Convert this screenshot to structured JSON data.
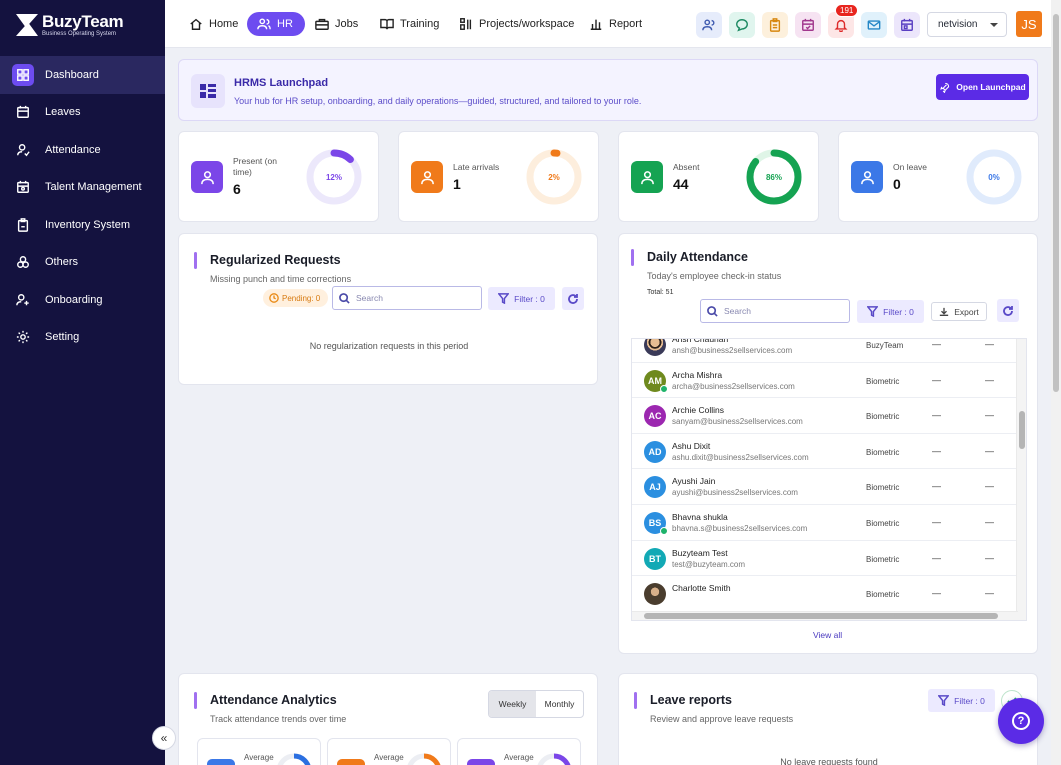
{
  "brand": {
    "name": "BuzyTeam",
    "tagline": "Business Operating System"
  },
  "sidebar": {
    "items": [
      {
        "label": "Dashboard",
        "icon": "dashboard-icon"
      },
      {
        "label": "Leaves",
        "icon": "calendar-icon"
      },
      {
        "label": "Attendance",
        "icon": "user-check-icon"
      },
      {
        "label": "Talent Management",
        "icon": "calendar-user-icon"
      },
      {
        "label": "Inventory System",
        "icon": "clipboard-icon"
      },
      {
        "label": "Others",
        "icon": "circles-icon"
      },
      {
        "label": "Onboarding",
        "icon": "user-plus-icon"
      },
      {
        "label": "Setting",
        "icon": "gear-icon"
      }
    ],
    "active": 0,
    "collapse_label": "«"
  },
  "topnav": {
    "tabs": [
      {
        "label": "Home",
        "icon": "home-icon"
      },
      {
        "label": "HR",
        "icon": "users-icon"
      },
      {
        "label": "Jobs",
        "icon": "briefcase-icon"
      },
      {
        "label": "Training",
        "icon": "book-icon"
      },
      {
        "label": "Projects/workspace",
        "icon": "projects-icon"
      },
      {
        "label": "Report",
        "icon": "bar-chart-icon"
      }
    ],
    "active": 1,
    "notification_count": "191",
    "org": "netvision",
    "user_initials": "JS"
  },
  "launchpad": {
    "title": "HRMS Launchpad",
    "subtitle": "Your hub for HR setup, onboarding, and daily operations—guided, structured, and tailored to your role.",
    "button": "Open Launchpad"
  },
  "stats": [
    {
      "label": "Present (on time)",
      "value": "6",
      "percent_label": "12%",
      "percent": 12,
      "color": "#7b46e8",
      "track": "#ece8fb",
      "icon_bg": "#7b46e8"
    },
    {
      "label": "Late arrivals",
      "value": "1",
      "percent_label": "2%",
      "percent": 2,
      "color": "#f07a1a",
      "track": "#fdeedd",
      "icon_bg": "#f07a1a"
    },
    {
      "label": "Absent",
      "value": "44",
      "percent_label": "86%",
      "percent": 86,
      "color": "#15a352",
      "track": "#dff5e7",
      "icon_bg": "#15a352"
    },
    {
      "label": "On leave",
      "value": "0",
      "percent_label": "0%",
      "percent": 0,
      "color": "#3b78e7",
      "track": "#e0ebfc",
      "icon_bg": "#3b78e7"
    }
  ],
  "regularized": {
    "title": "Regularized Requests",
    "subtitle": "Missing punch and time corrections",
    "pending": "Pending: 0",
    "search_placeholder": "Search",
    "filter": "Filter : 0",
    "empty": "No regularization requests in this period"
  },
  "daily": {
    "title": "Daily Attendance",
    "subtitle": "Today's employee check-in status",
    "total": "Total: 51",
    "search_placeholder": "Search",
    "filter": "Filter : 0",
    "export": "Export",
    "view_all": "View all",
    "rows": [
      {
        "name": "Ansh Chauhan",
        "email": "ansh@business2sellservices.com",
        "source": "BuzyTeam",
        "c1": "—",
        "c2": "—",
        "initials": "",
        "color": "photo",
        "verified": false
      },
      {
        "name": "Archa Mishra",
        "email": "archa@business2sellservices.com",
        "source": "Biometric",
        "c1": "—",
        "c2": "—",
        "initials": "AM",
        "color": "#6f8a1e",
        "verified": true
      },
      {
        "name": "Archie Collins",
        "email": "sanyam@business2sellservices.com",
        "source": "Biometric",
        "c1": "—",
        "c2": "—",
        "initials": "AC",
        "color": "#9c27b0",
        "verified": false
      },
      {
        "name": "Ashu Dixit",
        "email": "ashu.dixit@business2sellservices.com",
        "source": "Biometric",
        "c1": "—",
        "c2": "—",
        "initials": "AD",
        "color": "#2b8fe0",
        "verified": false
      },
      {
        "name": "Ayushi Jain",
        "email": "ayushi@business2sellservices.com",
        "source": "Biometric",
        "c1": "—",
        "c2": "—",
        "initials": "AJ",
        "color": "#2b8fe0",
        "verified": false
      },
      {
        "name": "Bhavna shukla",
        "email": "bhavna.s@business2sellservices.com",
        "source": "Biometric",
        "c1": "—",
        "c2": "—",
        "initials": "BS",
        "color": "#2b8fe0",
        "verified": true
      },
      {
        "name": "Buzyteam Test",
        "email": "test@buzyteam.com",
        "source": "Biometric",
        "c1": "—",
        "c2": "—",
        "initials": "BT",
        "color": "#12a9b5",
        "verified": false
      },
      {
        "name": "Charlotte Smith",
        "email": "",
        "source": "Biometric",
        "c1": "—",
        "c2": "—",
        "initials": "",
        "color": "photo2",
        "verified": false
      }
    ]
  },
  "analytics": {
    "title": "Attendance Analytics",
    "subtitle": "Track attendance trends over time",
    "weekly": "Weekly",
    "monthly": "Monthly",
    "minis": [
      {
        "label": "Average",
        "color": "#3b78e7",
        "ring": "#2b6fe0"
      },
      {
        "label": "Average",
        "color": "#f07a1a",
        "ring": "#f07a1a"
      },
      {
        "label": "Average",
        "color": "#7b46e8",
        "ring": "#7b46e8"
      }
    ]
  },
  "leave": {
    "title": "Leave reports",
    "subtitle": "Review and approve leave requests",
    "filter": "Filter : 0",
    "empty": "No leave requests found"
  },
  "help_label": "?"
}
